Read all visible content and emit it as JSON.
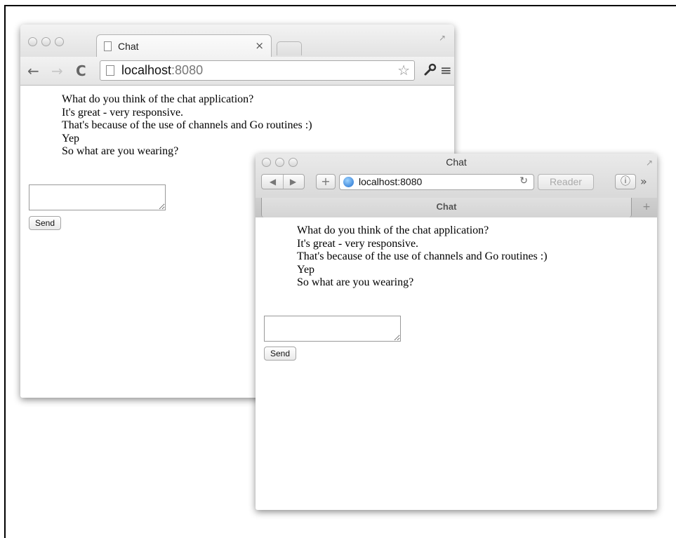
{
  "chrome_window": {
    "tab_title": "Chat",
    "tab_close": "×",
    "url_host": "localhost",
    "url_port": ":8080",
    "messages": [
      "What do you think of the chat application?",
      "It's great - very responsive.",
      "That's because of the use of channels and Go routines :)",
      "Yep",
      "So what are you wearing?"
    ],
    "message_input": {
      "value": "",
      "placeholder": ""
    },
    "send_label": "Send"
  },
  "safari_window": {
    "window_title": "Chat",
    "url": "localhost:8080",
    "reader_label": "Reader",
    "tab_title": "Chat",
    "messages": [
      "What do you think of the chat application?",
      "It's great - very responsive.",
      "That's because of the use of channels and Go routines :)",
      "Yep",
      "So what are you wearing?"
    ],
    "message_input": {
      "value": "",
      "placeholder": ""
    },
    "send_label": "Send"
  },
  "icons": [
    "back-arrow-icon",
    "forward-arrow-icon",
    "reload-icon",
    "page-icon",
    "star-icon",
    "wrench-icon",
    "menu-icon",
    "globe-icon",
    "download-icon",
    "overflow-icon",
    "add-bookmark-icon",
    "resize-icon"
  ]
}
